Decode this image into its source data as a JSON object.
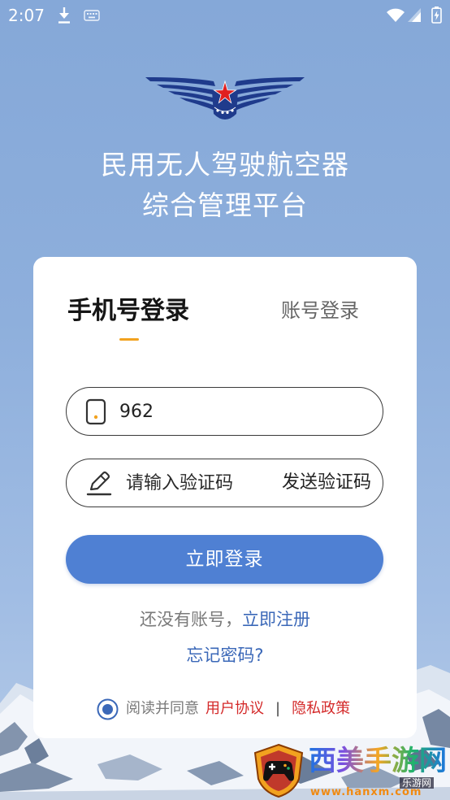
{
  "status_bar": {
    "time": "2:07",
    "left_icons": [
      "download-icon",
      "keyboard-icon"
    ],
    "right_icons": [
      "wifi-icon",
      "signal-icon",
      "battery-icon"
    ]
  },
  "header": {
    "logo_icon": "wings-star-logo-icon",
    "title_line1": "民用无人驾驶航空器",
    "title_line2": "综合管理平台"
  },
  "tabs": [
    {
      "label": "手机号登录",
      "active": true
    },
    {
      "label": "账号登录",
      "active": false
    }
  ],
  "form": {
    "phone": {
      "icon": "phone-icon",
      "value": "962"
    },
    "code": {
      "icon": "pen-icon",
      "placeholder": "请输入验证码",
      "send_label": "发送验证码"
    },
    "login_label": "立即登录"
  },
  "register": {
    "prompt": "还没有账号，",
    "link": "立即注册"
  },
  "forgot_password": "忘记密码?",
  "agreement": {
    "checked": true,
    "prefix": "阅读并同意",
    "user_agreement": "用户协议",
    "separator": "|",
    "privacy_policy": "隐私政策"
  },
  "watermark": {
    "name": "西美手游网",
    "badge": "乐游网",
    "url": "www.hanxm.com"
  },
  "colors": {
    "primary_button": "#4f80d3",
    "link": "#3b68b8",
    "policy_link": "#d42a2a",
    "tab_indicator": "#f2a21f",
    "logo_navy": "#1f3b8c",
    "logo_star": "#e02020"
  }
}
